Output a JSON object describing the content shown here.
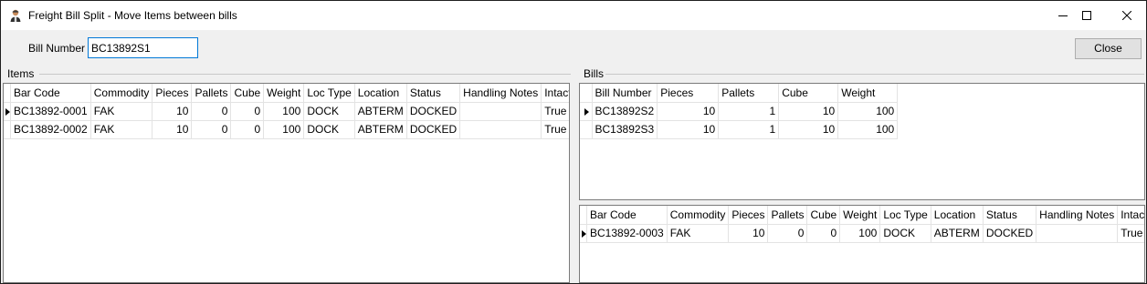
{
  "window": {
    "title": "Freight Bill Split - Move Items between bills",
    "icon": "worker-icon"
  },
  "toolbar": {
    "bill_label": "Bill Number",
    "bill_value": "BC13892S1",
    "close_label": "Close"
  },
  "items_group": {
    "label": "Items",
    "columns": [
      "Bar Code",
      "Commodity",
      "Pieces",
      "Pallets",
      "Cube",
      "Weight",
      "Loc Type",
      "Location",
      "Status",
      "Handling Notes",
      "Intact"
    ],
    "rows": [
      [
        "BC13892-0001",
        "FAK",
        "10",
        "0",
        "0",
        "100",
        "DOCK",
        "ABTERM",
        "DOCKED",
        "",
        "True"
      ],
      [
        "BC13892-0002",
        "FAK",
        "10",
        "0",
        "0",
        "100",
        "DOCK",
        "ABTERM",
        "DOCKED",
        "",
        "True"
      ]
    ],
    "current_row": 0
  },
  "bills_group": {
    "label": "Bills",
    "columns": [
      "Bill Number",
      "Pieces",
      "Pallets",
      "Cube",
      "Weight"
    ],
    "rows": [
      [
        "BC13892S2",
        "10",
        "1",
        "10",
        "100"
      ],
      [
        "BC13892S3",
        "10",
        "1",
        "10",
        "100"
      ]
    ],
    "current_row": 0
  },
  "bill_items": {
    "columns": [
      "Bar Code",
      "Commodity",
      "Pieces",
      "Pallets",
      "Cube",
      "Weight",
      "Loc Type",
      "Location",
      "Status",
      "Handling Notes",
      "Intact"
    ],
    "rows": [
      [
        "BC13892-0003",
        "FAK",
        "10",
        "0",
        "0",
        "100",
        "DOCK",
        "ABTERM",
        "DOCKED",
        "",
        "True"
      ]
    ],
    "current_row": 0
  }
}
